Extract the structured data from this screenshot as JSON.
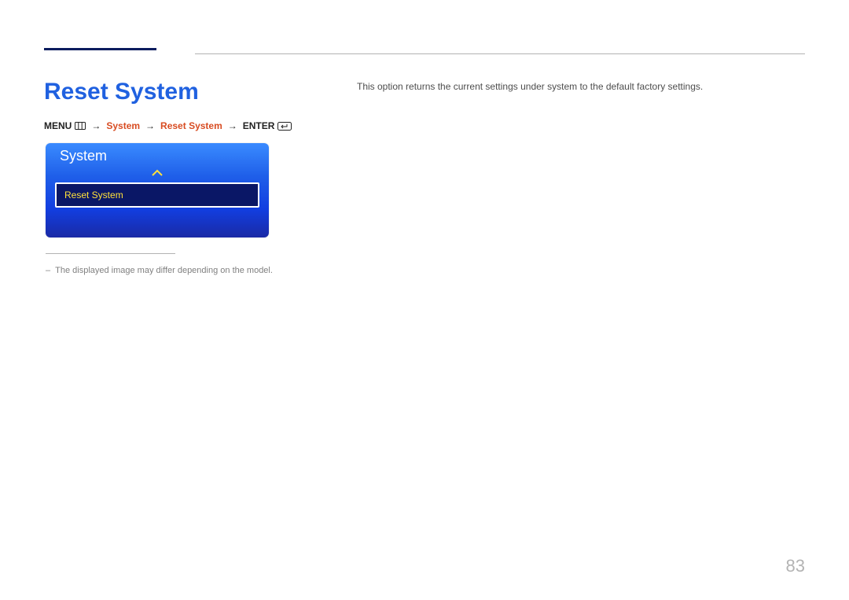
{
  "heading": "Reset System",
  "path": {
    "menu_label": "MENU",
    "arrow": "→",
    "system": "System",
    "reset": "Reset System",
    "enter_label": "ENTER"
  },
  "description": "This option returns the current settings under system to the default factory settings.",
  "panel": {
    "title": "System",
    "selected_item": "Reset System"
  },
  "footnote_dash": "–",
  "footnote": "The displayed image may differ depending on the model.",
  "page_number": "83"
}
